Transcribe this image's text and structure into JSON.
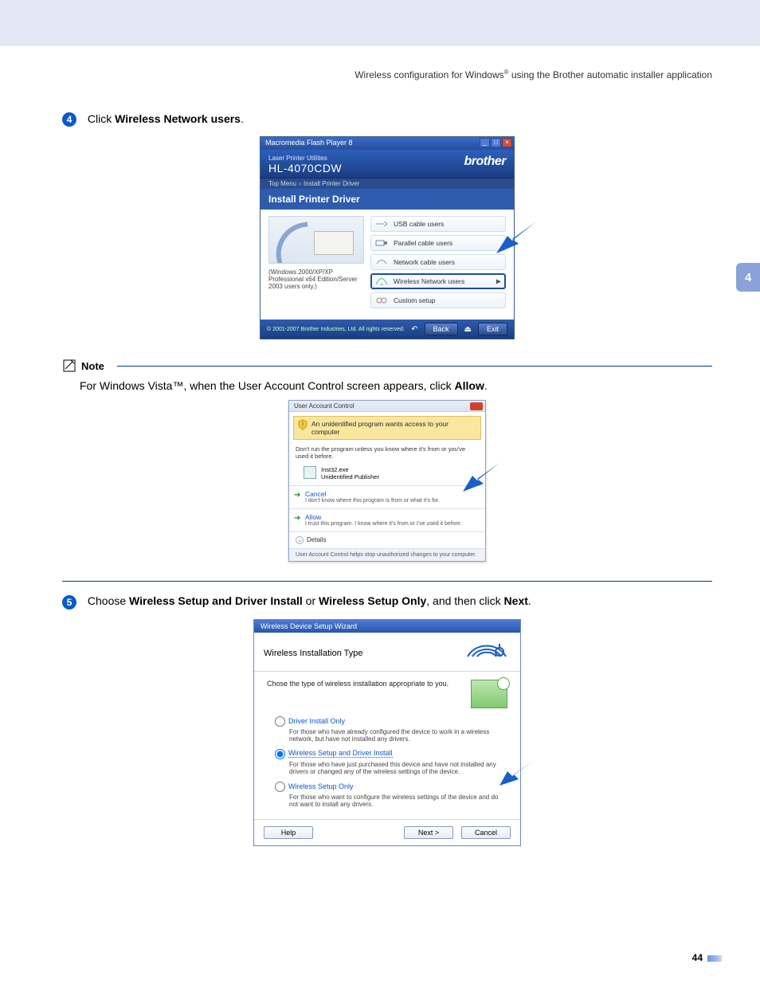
{
  "header": {
    "text_a": "Wireless configuration for Windows",
    "reg": "®",
    "text_b": " using the Brother automatic installer application"
  },
  "chapter_tab": "4",
  "page_number": "44",
  "step4": {
    "num": "4",
    "pre": "Click ",
    "bold": "Wireless Network users",
    "post": "."
  },
  "installer": {
    "titlebar": "Macromedia Flash Player 8",
    "win_min": "_",
    "win_max": "□",
    "win_close": "×",
    "sub": "Laser Printer Utilities",
    "model": "HL-4070CDW",
    "brand": "brother",
    "crumb_top": "Top Menu",
    "crumb_sep": " » ",
    "crumb_cur": "Install Printer Driver",
    "section": "Install Printer Driver",
    "left_note": "(Windows 2000/XP/XP Professional x64 Edition/Server 2003 users only.)",
    "opts": {
      "usb": "USB cable users",
      "parallel": "Parallel cable users",
      "network": "Network cable users",
      "wireless": "Wireless Network users",
      "custom": "Custom setup"
    },
    "back": "Back",
    "exit": "Exit",
    "copyright": "© 2001-2007 Brother Industries, Ltd. All rights reserved."
  },
  "note": {
    "label": "Note",
    "body_a": "For Windows Vista™, when the User Account Control screen appears, click ",
    "body_b": "Allow",
    "body_c": "."
  },
  "uac": {
    "title": "User Account Control",
    "banner": "An unidentified program wants access to your computer",
    "msg": "Don't run the program unless you know where it's from or you've used it before.",
    "prog_name": "Inst32.exe",
    "prog_pub": "Unidentified Publisher",
    "cancel_t": "Cancel",
    "cancel_s": "I don't know where this program is from or what it's for.",
    "allow_t": "Allow",
    "allow_s": "I trust this program. I know where it's from or I've used it before.",
    "details": "Details",
    "foot": "User Account Control helps stop unauthorized changes to your computer."
  },
  "step5": {
    "num": "5",
    "a": "Choose ",
    "b1": "Wireless Setup and Driver Install",
    "mid": " or ",
    "b2": "Wireless Setup Only",
    "c": ", and then click ",
    "b3": "Next",
    "d": "."
  },
  "wizard": {
    "titlebar": "Wireless Device Setup Wizard",
    "heading": "Wireless Installation Type",
    "lead": "Chose the type of wireless installation appropriate to you.",
    "r1_label": "Driver Install Only",
    "r1_desc": "For those who have already configured the device to work in a wireless network, but have not installed any drivers.",
    "r2_label": "Wireless Setup and Driver Install",
    "r2_desc": "For those who have just purchased this device and have not installed any drivers or changed any of the wireless settings of the device.",
    "r3_label": "Wireless Setup Only",
    "r3_desc": "For those who want to configure the wireless settings of the device and do not want to install any drivers.",
    "help": "Help",
    "next": "Next >",
    "cancel": "Cancel"
  }
}
